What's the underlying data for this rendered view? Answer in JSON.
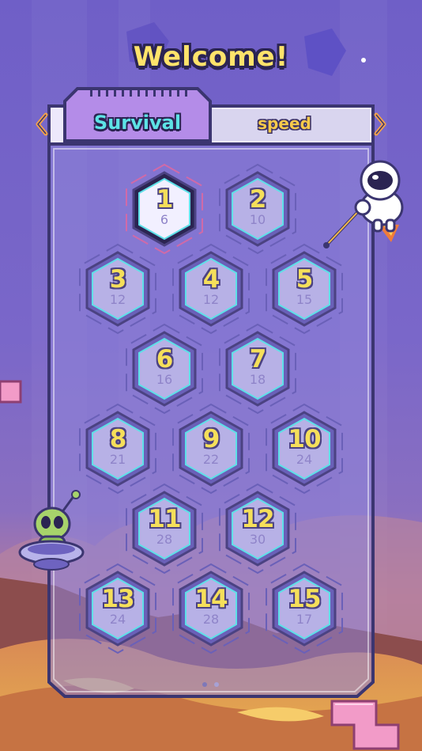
{
  "title": "Welcome!",
  "tabs": [
    {
      "label": "Survival",
      "active": true
    },
    {
      "label": "speed",
      "active": false
    }
  ],
  "levels": [
    {
      "num": "1",
      "score": "6",
      "selected": true
    },
    {
      "num": "2",
      "score": "10"
    },
    {
      "num": "3",
      "score": "12"
    },
    {
      "num": "4",
      "score": "12"
    },
    {
      "num": "5",
      "score": "15"
    },
    {
      "num": "6",
      "score": "16"
    },
    {
      "num": "7",
      "score": "18"
    },
    {
      "num": "8",
      "score": "21"
    },
    {
      "num": "9",
      "score": "22"
    },
    {
      "num": "10",
      "score": "24"
    },
    {
      "num": "11",
      "score": "28"
    },
    {
      "num": "12",
      "score": "30"
    },
    {
      "num": "13",
      "score": "24"
    },
    {
      "num": "14",
      "score": "28"
    },
    {
      "num": "15",
      "score": "17"
    }
  ],
  "pagination": {
    "pages": 2,
    "current": 1
  },
  "icons": [
    "chevron-left-icon",
    "chevron-right-icon",
    "astronaut-icon",
    "alien-ufo-icon",
    "tetromino-block-icon"
  ],
  "colors": {
    "title": "#ffe36b",
    "tab_active_bg": "#b48ce8",
    "tab_active_text": "#5de3e6",
    "tab_inactive_text": "#f6c94a",
    "level_number": "#f5df5a",
    "level_score": "#8f84c9",
    "panel_border": "#3b3570"
  }
}
